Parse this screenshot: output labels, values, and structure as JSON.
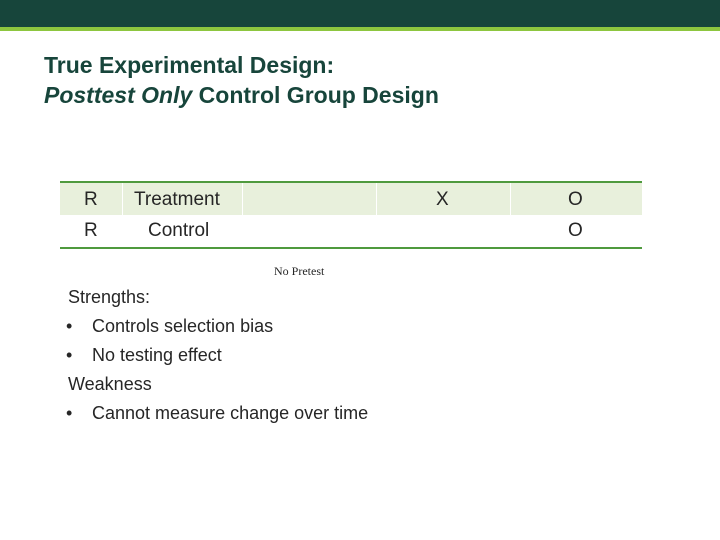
{
  "slide": {
    "title_line1": "True Experimental Design:",
    "title_line2_italic": "Posttest Only",
    "title_line2_rest": " Control Group Design"
  },
  "design_table": {
    "rows": [
      {
        "assignment": "R",
        "group": "Treatment",
        "intervention": "X",
        "observation": "O"
      },
      {
        "assignment": "R",
        "group": "Control",
        "intervention": "",
        "observation": "O"
      }
    ]
  },
  "annotation": "No Pretest",
  "notes": {
    "strengths_heading": "Strengths:",
    "strengths": [
      "Controls selection bias",
      "No testing effect"
    ],
    "weakness_heading": "Weakness",
    "weaknesses": [
      "Cannot measure change over time"
    ],
    "bullet": "•"
  },
  "colors": {
    "header_bar": "#17453b",
    "accent": "#8dc63f",
    "title": "#17453b",
    "table_rule": "#4f9a3e",
    "row_shade": "#e8f0dc"
  }
}
